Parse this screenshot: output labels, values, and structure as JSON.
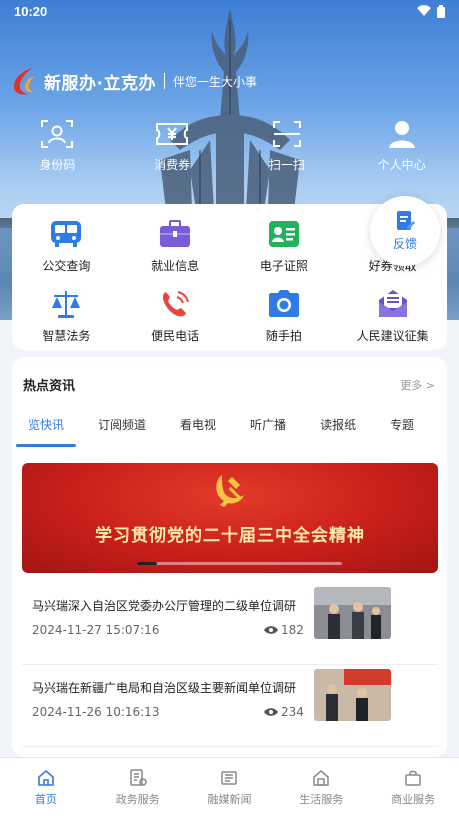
{
  "status_bar": {
    "time": "10:20"
  },
  "brand": {
    "title": "新服办·立克办",
    "slogan": "伴您一生大小事"
  },
  "quick_actions": [
    {
      "label": "身份码",
      "icon": "id-code-icon"
    },
    {
      "label": "消费券",
      "icon": "coupon-icon"
    },
    {
      "label": "扫一扫",
      "icon": "scan-icon"
    },
    {
      "label": "个人中心",
      "icon": "user-icon"
    }
  ],
  "services": [
    {
      "label": "公交查询",
      "icon": "bus-icon"
    },
    {
      "label": "就业信息",
      "icon": "briefcase-icon"
    },
    {
      "label": "电子证照",
      "icon": "id-card-icon"
    },
    {
      "label": "好券领取",
      "icon": "coupon-icon"
    },
    {
      "label": "智慧法务",
      "icon": "scales-icon"
    },
    {
      "label": "便民电话",
      "icon": "phone-icon"
    },
    {
      "label": "随手拍",
      "icon": "camera-icon"
    },
    {
      "label": "人民建议征集",
      "icon": "mail-icon"
    }
  ],
  "feedback": {
    "label": "反馈"
  },
  "news": {
    "title": "热点资讯",
    "more": "更多 >",
    "tabs": [
      "览快讯",
      "订阅频道",
      "看电视",
      "听广播",
      "读报纸",
      "专题"
    ],
    "active_tab": 0,
    "banner_text": "学习贯彻党的二十届三中全会精神",
    "items": [
      {
        "headline": "马兴瑞深入自治区党委办公厅管理的二级单位调研",
        "date": "2024-11-27 15:07:16",
        "views": "182"
      },
      {
        "headline": "马兴瑞在新疆广电局和自治区级主要新闻单位调研",
        "date": "2024-11-26 10:16:13",
        "views": "234"
      }
    ]
  },
  "bottom_nav": [
    {
      "label": "首页",
      "icon": "home-icon",
      "active": true
    },
    {
      "label": "政务服务",
      "icon": "gov-service-icon"
    },
    {
      "label": "融媒新闻",
      "icon": "news-icon"
    },
    {
      "label": "生活服务",
      "icon": "life-service-icon"
    },
    {
      "label": "商业服务",
      "icon": "shopping-bag-icon"
    }
  ],
  "colors": {
    "accent": "#2f7be6",
    "banner_red": "#c91f1a"
  }
}
